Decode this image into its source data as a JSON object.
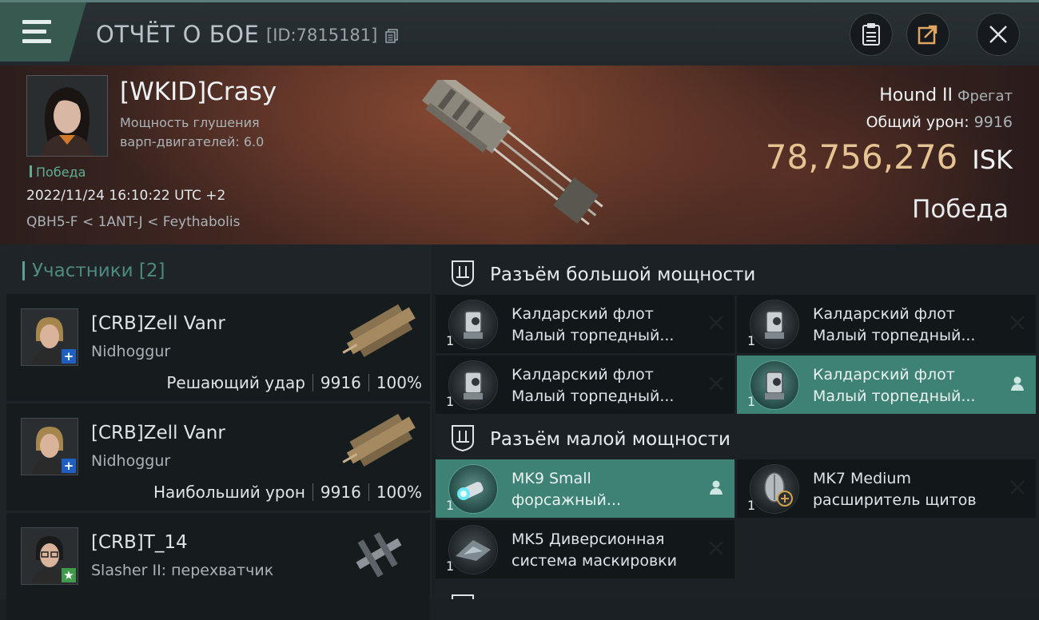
{
  "header": {
    "title": "ОТЧЁТ О БОЕ",
    "report_id": "[ID:7815181]"
  },
  "victim": {
    "name": "[WKID]Crasy",
    "warp_line1": "Мощность глушения",
    "warp_line2": "варп-двигателей: 6.0",
    "status": "Победа",
    "datetime": "2022/11/24 16:10:22 UTC +2",
    "location": "QBH5-F < 1ANT-J < Feythabolis",
    "ship": "Hound II",
    "ship_class": "Фрегат",
    "total_damage_label": "Общий урон:",
    "total_damage": "9916",
    "isk_value": "78,756,276",
    "isk_unit": "ISK",
    "result": "Победа"
  },
  "participants": {
    "title": "Участники [2]",
    "rows": [
      {
        "name": "[CRB]Zell Vanr",
        "ship": "Nidhoggur",
        "role": "Решающий удар",
        "damage": "9916",
        "percent": "100%",
        "badge": "+",
        "badge_color": "#1f5fc4"
      },
      {
        "name": "[CRB]Zell Vanr",
        "ship": "Nidhoggur",
        "role": "Наибольший урон",
        "damage": "9916",
        "percent": "100%",
        "badge": "+",
        "badge_color": "#1f5fc4"
      },
      {
        "name": "[CRB]T_14",
        "ship": "Slasher II: перехватчик",
        "badge": "★",
        "badge_color": "#3f9a4a"
      }
    ]
  },
  "fittings": {
    "high_slot_title": "Разъём большой мощности",
    "low_slot_title": "Разъём малой мощности",
    "high_slots": [
      {
        "line1": "Калдарский флот",
        "line2": "Малый торпедный...",
        "qty": "1",
        "state": "destroyed",
        "icon": "torpedo-launcher-icon"
      },
      {
        "line1": "Калдарский флот",
        "line2": "Малый торпедный...",
        "qty": "1",
        "state": "destroyed",
        "icon": "torpedo-launcher-icon"
      },
      {
        "line1": "Калдарский флот",
        "line2": "Малый торпедный...",
        "qty": "1",
        "state": "destroyed",
        "icon": "torpedo-launcher-icon"
      },
      {
        "line1": "Калдарский флот",
        "line2": "Малый торпедный...",
        "qty": "1",
        "state": "dropped",
        "icon": "torpedo-launcher-icon"
      }
    ],
    "low_slots": [
      {
        "line1": "MK9 Small",
        "line2": "форсажный...",
        "qty": "1",
        "state": "dropped",
        "icon": "afterburner-icon"
      },
      {
        "line1": "MK7 Medium",
        "line2": "расширитель щитов",
        "qty": "1",
        "state": "destroyed",
        "icon": "shield-extender-icon"
      },
      {
        "line1": "MK5 Диверсионная",
        "line2": "система маскировки",
        "qty": "1",
        "state": "destroyed",
        "icon": "cloaking-device-icon"
      }
    ]
  },
  "colors": {
    "accent": "#3e8276",
    "isk": "#e6c392",
    "victory": "#5fae94"
  }
}
